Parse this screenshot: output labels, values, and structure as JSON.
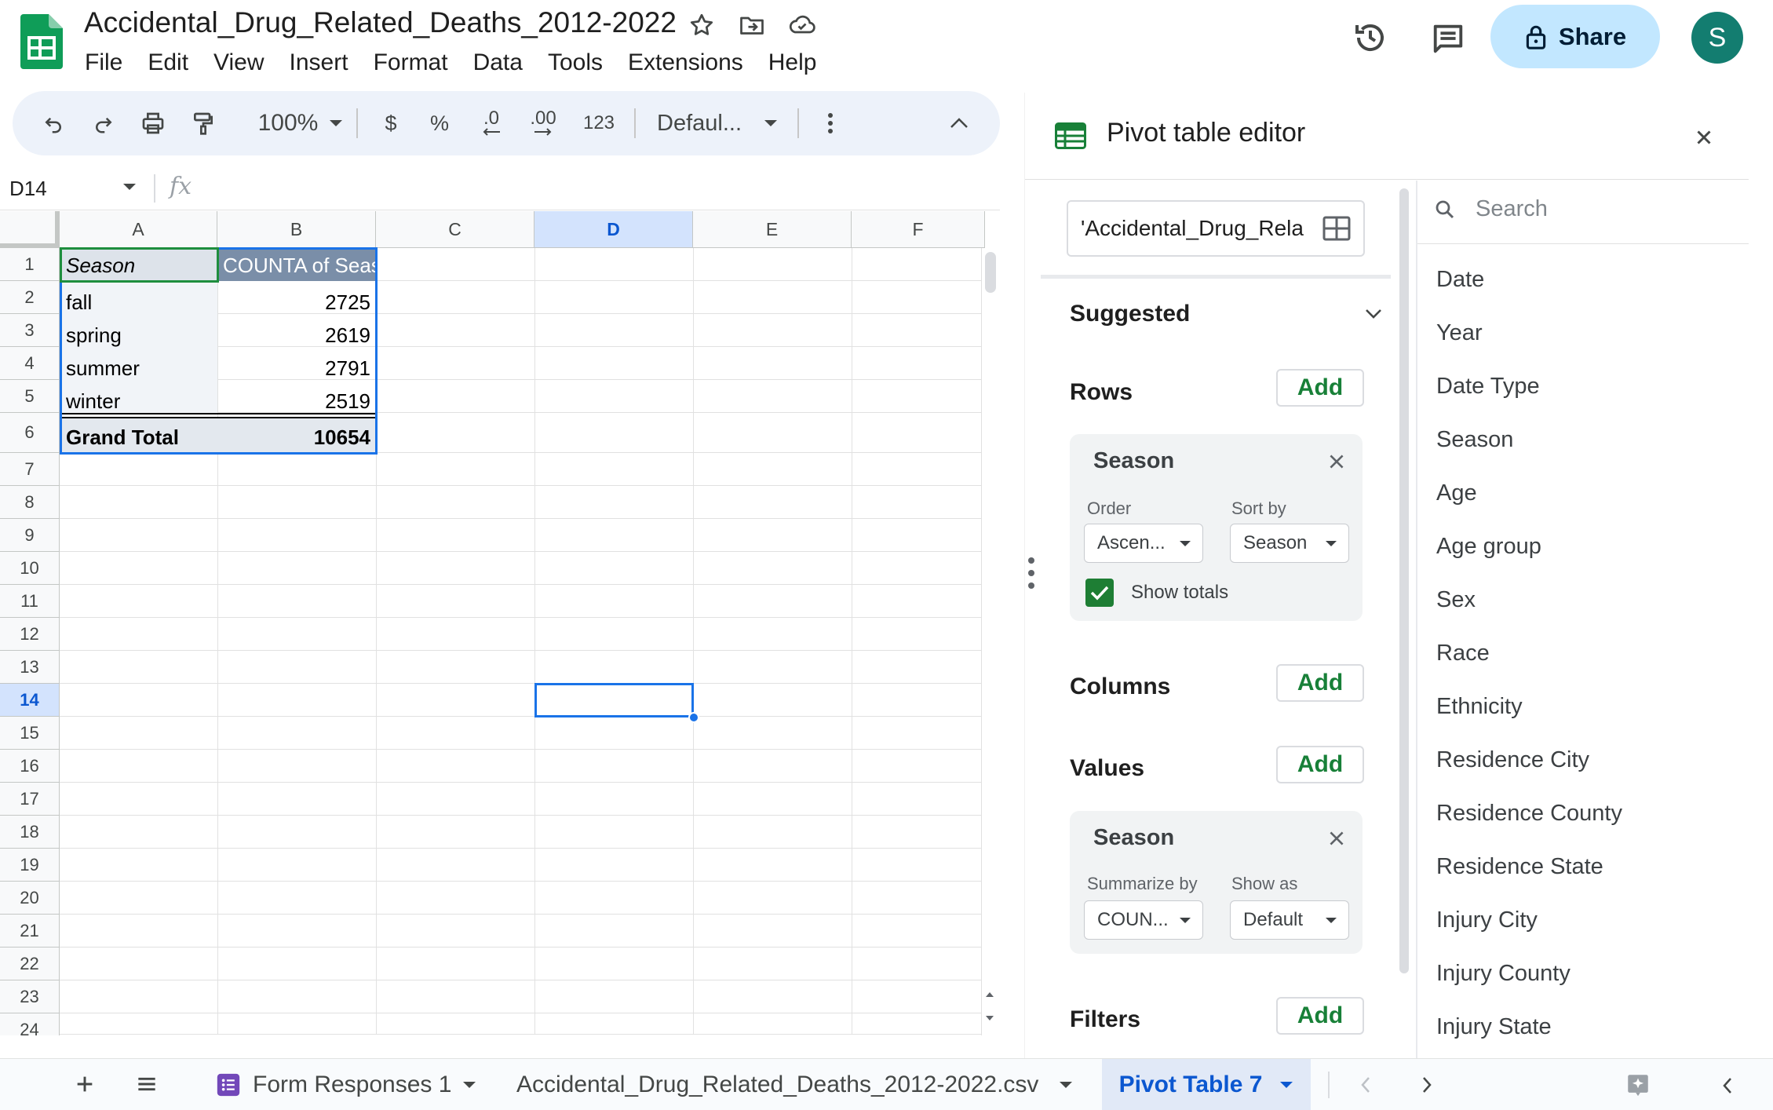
{
  "app": {
    "doc_title": "Accidental_Drug_Related_Deaths_2012-2022",
    "menu": [
      "File",
      "Edit",
      "View",
      "Insert",
      "Format",
      "Data",
      "Tools",
      "Extensions",
      "Help"
    ],
    "share_label": "Share",
    "avatar_letter": "S"
  },
  "toolbar": {
    "zoom": "100%",
    "currency": "$",
    "percent": "%",
    "decrease_decimal": ".0",
    "increase_decimal": ".00",
    "number_format": "123",
    "font": "Defaul..."
  },
  "formula_bar": {
    "name_box": "D14",
    "fx": "fx"
  },
  "grid": {
    "columns": [
      "A",
      "B",
      "C",
      "D",
      "E",
      "F"
    ],
    "selected_column": "D",
    "rows": [
      "1",
      "2",
      "3",
      "4",
      "5",
      "6",
      "7",
      "8",
      "9",
      "10",
      "11",
      "12",
      "13",
      "14",
      "15",
      "16",
      "17",
      "18",
      "19",
      "20",
      "21",
      "22",
      "23",
      "24"
    ],
    "selected_row": "14",
    "cells": {
      "A1": "Season",
      "B1": "COUNTA of Season",
      "A2": "fall",
      "B2": "2725",
      "A3": "spring",
      "B3": "2619",
      "A4": "summer",
      "B4": "2791",
      "A5": "winter",
      "B5": "2519",
      "A6": "Grand Total",
      "B6": "10654"
    }
  },
  "sheet_tabs": {
    "tabs": [
      "Form Responses 1",
      "Accidental_Drug_Related_Deaths_2012-2022.csv",
      "Pivot Table 7"
    ],
    "active_tab": "Pivot Table 7"
  },
  "pivot_editor": {
    "title": "Pivot table editor",
    "range": "'Accidental_Drug_Rela",
    "suggested": "Suggested",
    "rows_label": "Rows",
    "columns_label": "Columns",
    "values_label": "Values",
    "filters_label": "Filters",
    "add_label": "Add",
    "row_card": {
      "field": "Season",
      "order_label": "Order",
      "order_value": "Ascen...",
      "sort_by_label": "Sort by",
      "sort_by_value": "Season",
      "show_totals_label": "Show totals",
      "show_totals_checked": true
    },
    "value_card": {
      "field": "Season",
      "summarize_label": "Summarize by",
      "summarize_value": "COUN...",
      "show_as_label": "Show as",
      "show_as_value": "Default"
    },
    "search_placeholder": "Search",
    "fields": [
      "Date",
      "Year",
      "Date Type",
      "Season",
      "Age",
      "Age group",
      "Sex",
      "Race",
      "Ethnicity",
      "Residence City",
      "Residence County",
      "Residence State",
      "Injury City",
      "Injury County",
      "Injury State"
    ]
  },
  "colors": {
    "accent_blue": "#0b57d0",
    "share_bg": "#c2e7ff",
    "add_green": "#188038",
    "pivot_header_bg": "#7a8ea8",
    "sheets_green": "#0f9d58",
    "avatar_bg": "#137d70"
  }
}
